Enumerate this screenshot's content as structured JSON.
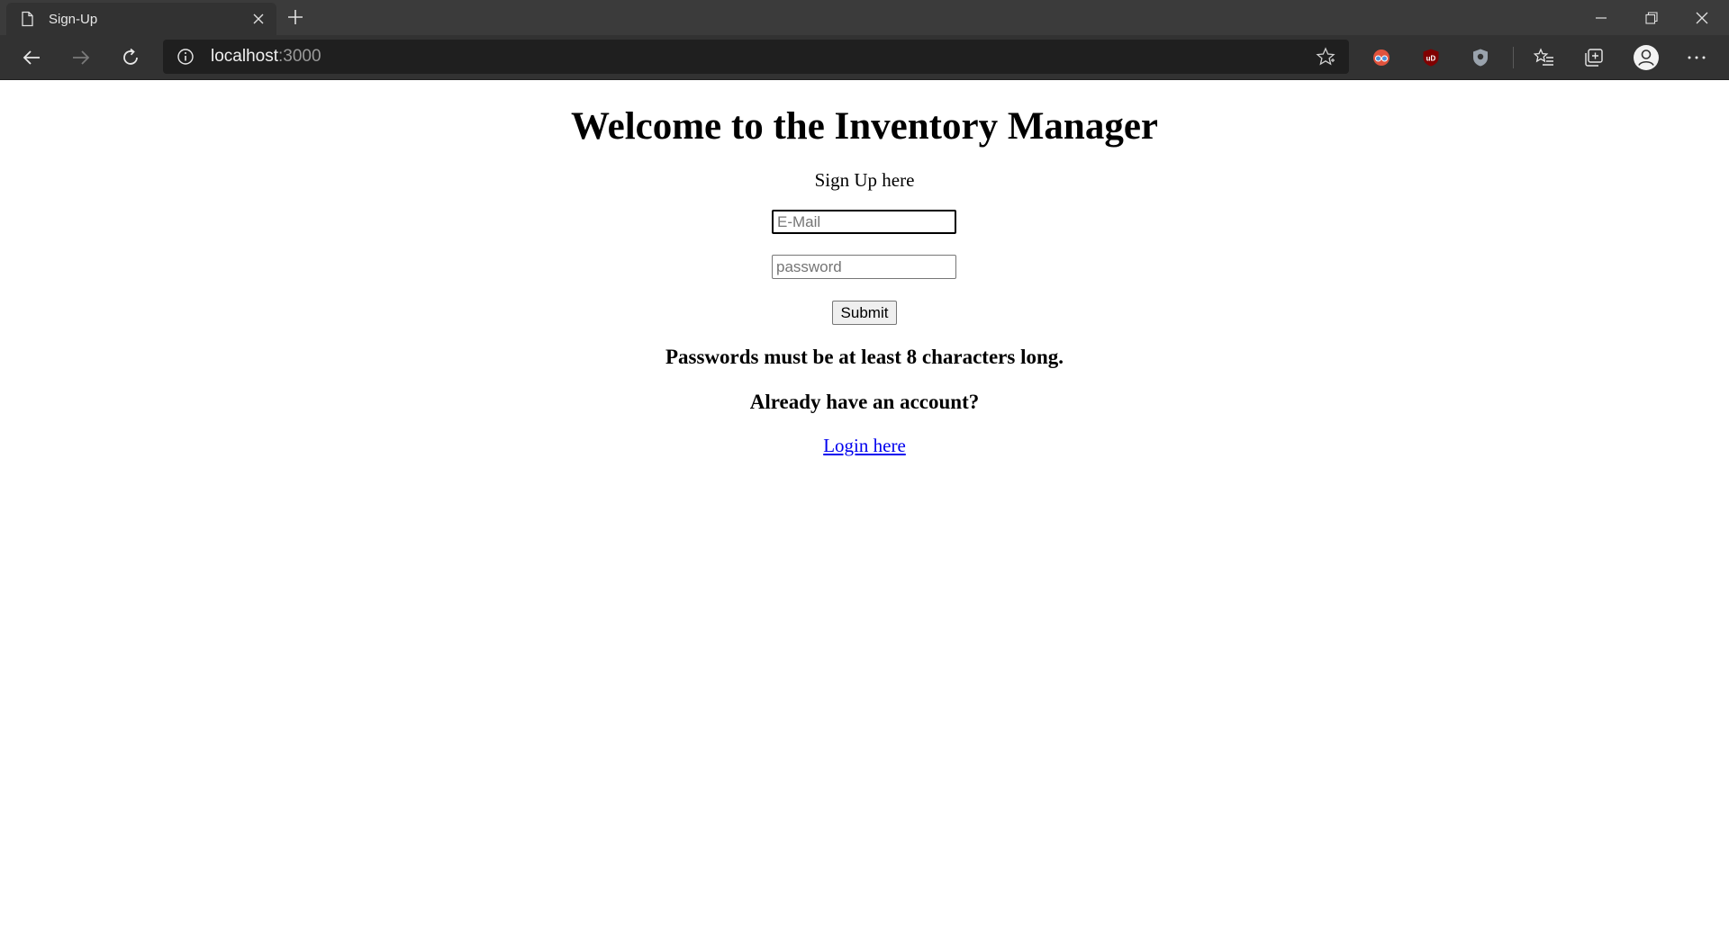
{
  "browser": {
    "tab_title": "Sign-Up",
    "url_host": "localhost",
    "url_port": ":3000",
    "icons": [
      "page-icon",
      "close-icon",
      "plus-icon",
      "minimize-icon",
      "restore-icon",
      "close-window-icon",
      "back-arrow-icon",
      "forward-arrow-icon",
      "refresh-icon",
      "info-icon",
      "star-icon",
      "extension-glasses-icon",
      "ublock-icon",
      "shield-icon",
      "favorites-icon",
      "collections-icon",
      "profile-icon",
      "more-icon"
    ]
  },
  "page": {
    "heading": "Welcome to the Inventory Manager",
    "lead": "Sign Up here",
    "email": {
      "placeholder": "E-Mail",
      "value": ""
    },
    "password": {
      "placeholder": "password",
      "value": ""
    },
    "submit_label": "Submit",
    "password_note": "Passwords must be at least 8 characters long.",
    "account_prompt": "Already have an account?",
    "login_link": "Login here"
  },
  "colors": {
    "chrome_dark": "#323232",
    "titlebar": "#3b3b3b",
    "link": "#0000ee"
  }
}
